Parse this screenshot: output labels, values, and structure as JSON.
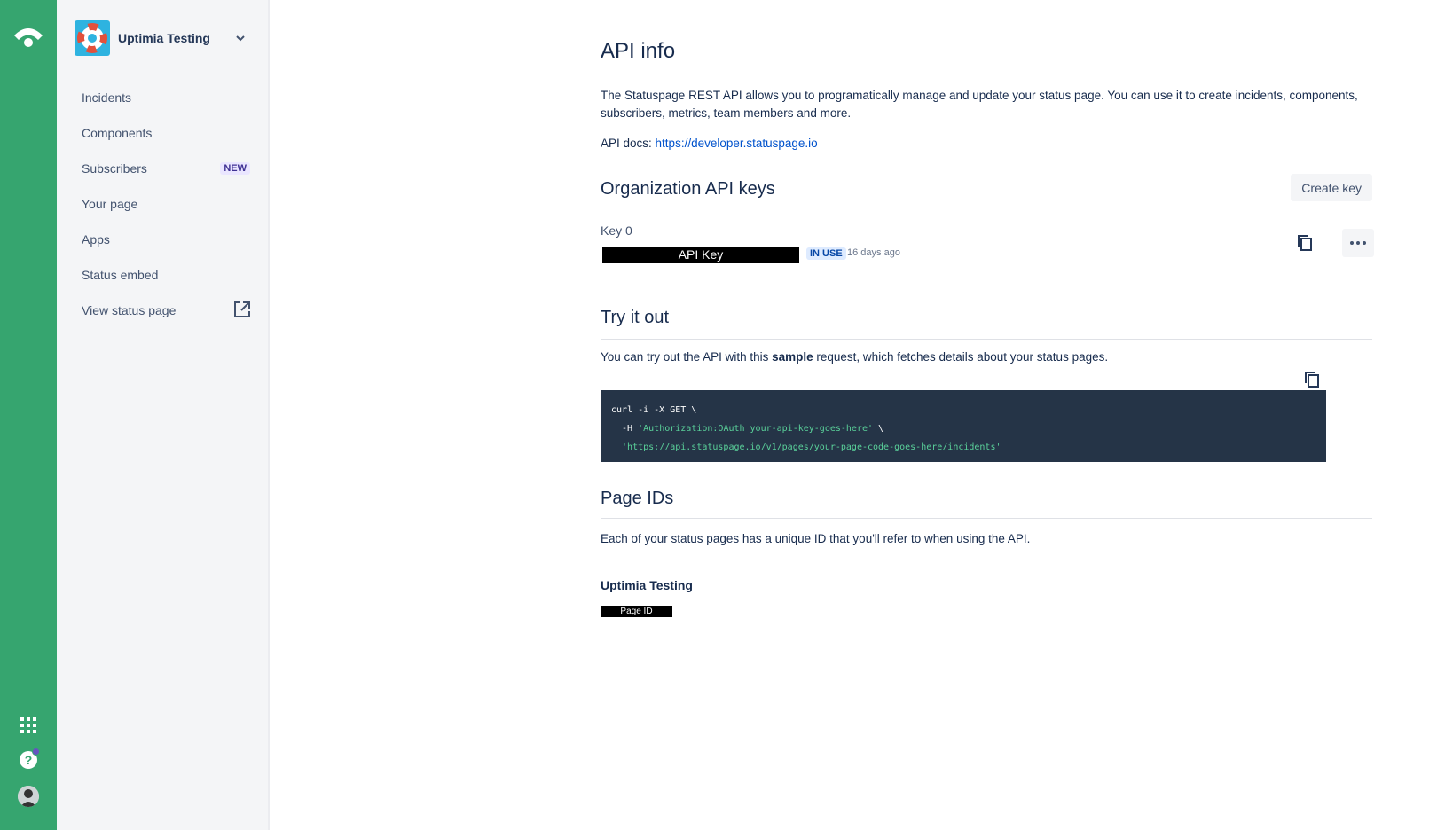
{
  "sidebar": {
    "project_name": "Uptimia Testing",
    "items": [
      {
        "label": "Incidents"
      },
      {
        "label": "Components"
      },
      {
        "label": "Subscribers",
        "badge": "NEW"
      },
      {
        "label": "Your page"
      },
      {
        "label": "Apps"
      },
      {
        "label": "Status embed"
      },
      {
        "label": "View status page"
      }
    ]
  },
  "main": {
    "title": "API info",
    "intro": "The Statuspage REST API allows you to programatically manage and update your status page. You can use it to create incidents, components, subscribers, metrics, team members and more.",
    "docs_label": "API docs:",
    "docs_link": "https://developer.statuspage.io",
    "org_keys": {
      "heading": "Organization API keys",
      "create_label": "Create key",
      "key_name": "Key 0",
      "key_value": "API Key",
      "status": "IN USE",
      "age": "16 days ago"
    },
    "try_it": {
      "heading": "Try it out",
      "text_before": "You can try out the API with this ",
      "text_bold": "sample",
      "text_after": " request, which fetches details about your status pages.",
      "code_line1": "curl -i -X GET \\",
      "code_line2_flag": "  -H ",
      "code_line2_str": "'Authorization:OAuth your-api-key-goes-here'",
      "code_line2_end": " \\",
      "code_line3_str": "  'https://api.statuspage.io/v1/pages/your-page-code-goes-here/incidents'"
    },
    "page_ids": {
      "heading": "Page IDs",
      "text": "Each of your status pages has a unique ID that you'll refer to when using the API.",
      "page_name": "Uptimia Testing",
      "page_id": "Page ID"
    }
  },
  "colors": {
    "rail": "#36a56f",
    "link": "#0052cc",
    "code_bg": "#253447",
    "code_string": "#5ad19a"
  }
}
